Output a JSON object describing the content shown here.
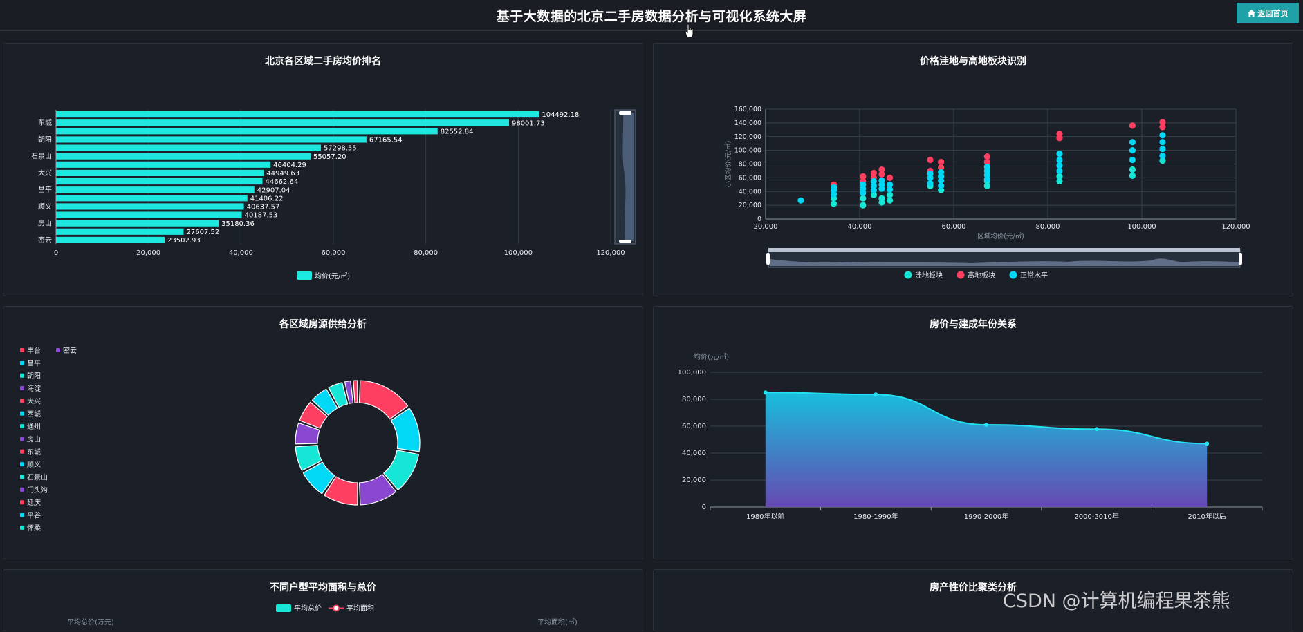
{
  "header": {
    "title": "基于大数据的北京二手房数据分析与可视化系统大屏",
    "home_label": "返回首页"
  },
  "colors": {
    "cyan": "#1ce8e0",
    "red": "#ff3f62",
    "blue": "#00d8f6",
    "purple": "#8a48d0",
    "teal": "#16e6d6"
  },
  "watermark": "CSDN @计算机编程果茶熊",
  "chart_data": [
    {
      "id": "price_rank",
      "type": "bar",
      "title": "北京各区域二手房均价排名",
      "orientation": "horizontal",
      "categories": [
        "东城",
        "朝阳",
        "石景山",
        "大兴",
        "昌平",
        "顺义",
        "房山",
        "密云"
      ],
      "values": [
        104492.18,
        98001.73,
        82552.84,
        67165.54,
        57298.55,
        55057.2,
        46404.29,
        44949.63,
        44662.64,
        42907.04,
        41406.22,
        40637.57,
        40187.53,
        35180.36,
        27607.52,
        23502.93
      ],
      "value_labels": [
        "104492.18",
        "98001.73",
        "82552.84",
        "67165.54",
        "57298.55",
        "55057.20",
        "46404.29",
        "44949.63",
        "44662.64",
        "42907.04",
        "41406.22",
        "40637.57",
        "40187.53",
        "35180.36",
        "27607.52",
        "23502.93"
      ],
      "x_ticks": [
        "0",
        "20,000",
        "40,000",
        "60,000",
        "80,000",
        "100,000",
        "120,000"
      ],
      "xlim": [
        0,
        120000
      ],
      "legend": "均价(元/㎡)",
      "legend_position": "bottom"
    },
    {
      "id": "price_depression",
      "type": "scatter",
      "title": "价格洼地与高地板块识别",
      "xlabel": "区域均价(元/㎡)",
      "ylabel": "小区均价(元/㎡)",
      "xlim": [
        20000,
        120000
      ],
      "ylim": [
        0,
        160000
      ],
      "x_ticks": [
        "20,000",
        "40,000",
        "60,000",
        "80,000",
        "100,000",
        "120,000"
      ],
      "y_ticks": [
        "0",
        "20,000",
        "40,000",
        "60,000",
        "80,000",
        "100,000",
        "120,000",
        "140,000",
        "160,000"
      ],
      "legend_position": "bottom",
      "series": [
        {
          "name": "洼地板块",
          "color": "#16e6d6",
          "x": [
            34500,
            34500,
            40700,
            40700,
            43000,
            44700,
            44700,
            46400,
            46400,
            55000,
            57300,
            67100,
            67100,
            82500,
            82500,
            98000,
            98000,
            104400
          ],
          "y": [
            22000,
            30000,
            20000,
            30000,
            35000,
            24000,
            30000,
            27000,
            35000,
            48000,
            42000,
            48000,
            55000,
            55000,
            62000,
            63000,
            72000,
            85000
          ]
        },
        {
          "name": "高地板块",
          "color": "#ff3f62",
          "x": [
            34500,
            40700,
            40700,
            43000,
            43000,
            44700,
            44700,
            46400,
            55000,
            55000,
            57300,
            57300,
            67100,
            67100,
            82500,
            82500,
            98000,
            104400,
            104400
          ],
          "y": [
            50000,
            55000,
            62000,
            60000,
            67000,
            65000,
            72000,
            60000,
            70000,
            86000,
            75000,
            83000,
            83000,
            91000,
            118000,
            124000,
            136000,
            134000,
            141000
          ]
        },
        {
          "name": "正常水平",
          "color": "#00d8f6",
          "x": [
            27500,
            34500,
            34500,
            34500,
            40700,
            40700,
            40700,
            43000,
            43000,
            43000,
            44700,
            44700,
            44700,
            46400,
            46400,
            55000,
            55000,
            55000,
            57300,
            57300,
            57300,
            57300,
            67100,
            67100,
            67100,
            67100,
            82500,
            82500,
            82500,
            82500,
            98000,
            98000,
            98000,
            104400,
            104400,
            104400,
            104400
          ],
          "y": [
            27000,
            36000,
            42000,
            46000,
            38000,
            44000,
            50000,
            42000,
            48000,
            55000,
            44000,
            50000,
            56000,
            43000,
            50000,
            52000,
            60000,
            66000,
            48000,
            56000,
            62000,
            68000,
            58000,
            64000,
            70000,
            76000,
            70000,
            78000,
            86000,
            95000,
            86000,
            100000,
            112000,
            92000,
            102000,
            112000,
            122000
          ]
        }
      ]
    },
    {
      "id": "supply",
      "type": "pie",
      "title": "各区域房源供给分析",
      "legend_position": "left",
      "legend": [
        "丰台",
        "密云",
        "昌平",
        "朝阳",
        "海淀",
        "大兴",
        "西城",
        "通州",
        "房山",
        "东城",
        "顺义",
        "石景山",
        "门头沟",
        "延庆",
        "平谷",
        "怀柔"
      ],
      "legend_colors": [
        "#ff3f62",
        "#8a48d0",
        "#00d8f6",
        "#16e6d6",
        "#8a48d0",
        "#ff3f62",
        "#00d8f6",
        "#16e6d6",
        "#8a48d0",
        "#ff3f62",
        "#00d8f6",
        "#16e6d6",
        "#8a48d0",
        "#ff3f62",
        "#00d8f6",
        "#16e6d6"
      ],
      "slices": [
        {
          "value": 17,
          "color": "#ff3f62"
        },
        {
          "value": 14,
          "color": "#00d8f6"
        },
        {
          "value": 13,
          "color": "#16e6d6"
        },
        {
          "value": 12,
          "color": "#8a48d0"
        },
        {
          "value": 11,
          "color": "#ff3f62"
        },
        {
          "value": 9,
          "color": "#00d8f6"
        },
        {
          "value": 8,
          "color": "#16e6d6"
        },
        {
          "value": 7,
          "color": "#8a48d0"
        },
        {
          "value": 7,
          "color": "#ff3f62"
        },
        {
          "value": 6,
          "color": "#00d8f6"
        },
        {
          "value": 5,
          "color": "#16e6d6"
        },
        {
          "value": 2.5,
          "color": "#8a48d0"
        },
        {
          "value": 2,
          "color": "#ff3f62"
        }
      ]
    },
    {
      "id": "build_year",
      "type": "area",
      "title": "房价与建成年份关系",
      "ylabel": "均价(元/㎡)",
      "categories": [
        "1980年以前",
        "1980-1990年",
        "1990-2000年",
        "2000-2010年",
        "2010年以后"
      ],
      "values": [
        85000,
        83500,
        61000,
        57800,
        47000
      ],
      "ylim": [
        0,
        100000
      ],
      "y_ticks": [
        "0",
        "20,000",
        "40,000",
        "60,000",
        "80,000",
        "100,000"
      ]
    },
    {
      "id": "house_type",
      "type": "bar",
      "title": "不同户型平均面积与总价",
      "legend": [
        "平均总价",
        "平均面积"
      ],
      "y_left_label": "平均总价(万元)",
      "y_right_label": "平均面积(㎡)"
    },
    {
      "id": "cluster",
      "type": "scatter",
      "title": "房产性价比聚类分析"
    }
  ]
}
